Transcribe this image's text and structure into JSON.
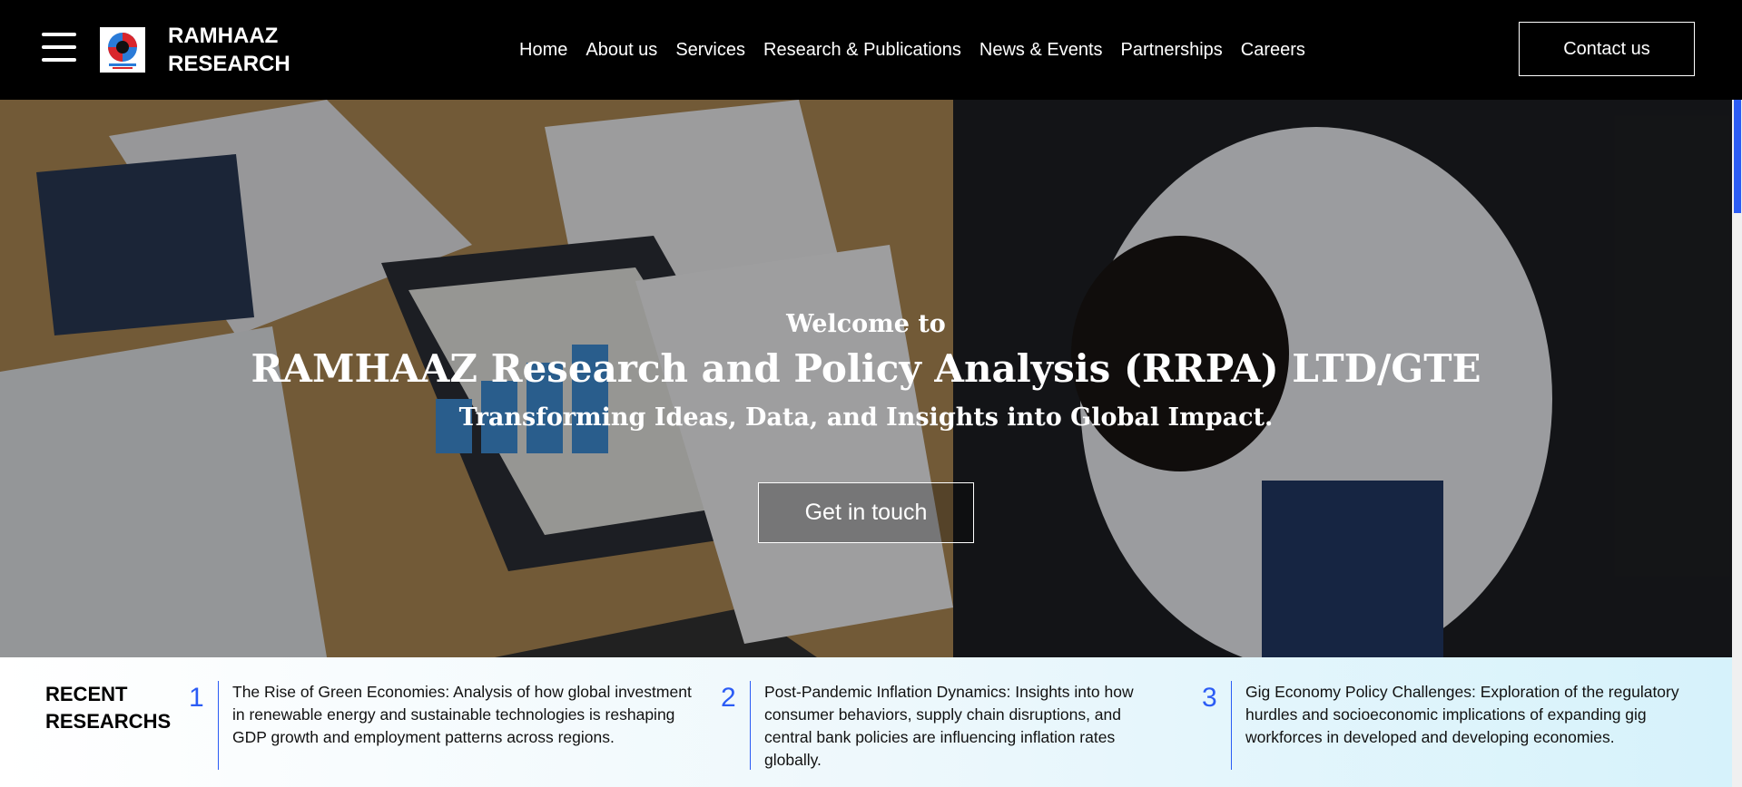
{
  "header": {
    "brand_line1": "RAMHAAZ",
    "brand_line2": "RESEARCH",
    "nav": [
      "Home",
      "About us",
      "Services",
      "Research & Publications",
      "News & Events",
      "Partnerships",
      "Careers"
    ],
    "contact_label": "Contact us"
  },
  "hero": {
    "welcome": "Welcome to",
    "title": "RAMHAAZ Research and Policy Analysis (RRPA) LTD/GTE",
    "tagline": "Transforming Ideas, Data, and Insights into Global Impact.",
    "cta": "Get in touch"
  },
  "recent": {
    "title_line1": "RECENT",
    "title_line2": "RESEARCHS",
    "items": [
      {
        "num": "1",
        "text": "The Rise of Green Economies: Analysis of how global investment in renewable energy and sustainable technologies is reshaping GDP growth and employment patterns across regions."
      },
      {
        "num": "2",
        "text": "Post-Pandemic Inflation Dynamics: Insights into how consumer behaviors, supply chain disruptions, and central bank policies are influencing inflation rates globally."
      },
      {
        "num": "3",
        "text": "Gig Economy Policy Challenges: Exploration of the regulatory hurdles and socioeconomic implications of expanding gig workforces in developed and developing economies."
      }
    ]
  },
  "colors": {
    "accent": "#2b5cf5",
    "header_bg": "#000000"
  },
  "icons": {
    "menu": "hamburger-icon",
    "logo": "brand-logo"
  }
}
